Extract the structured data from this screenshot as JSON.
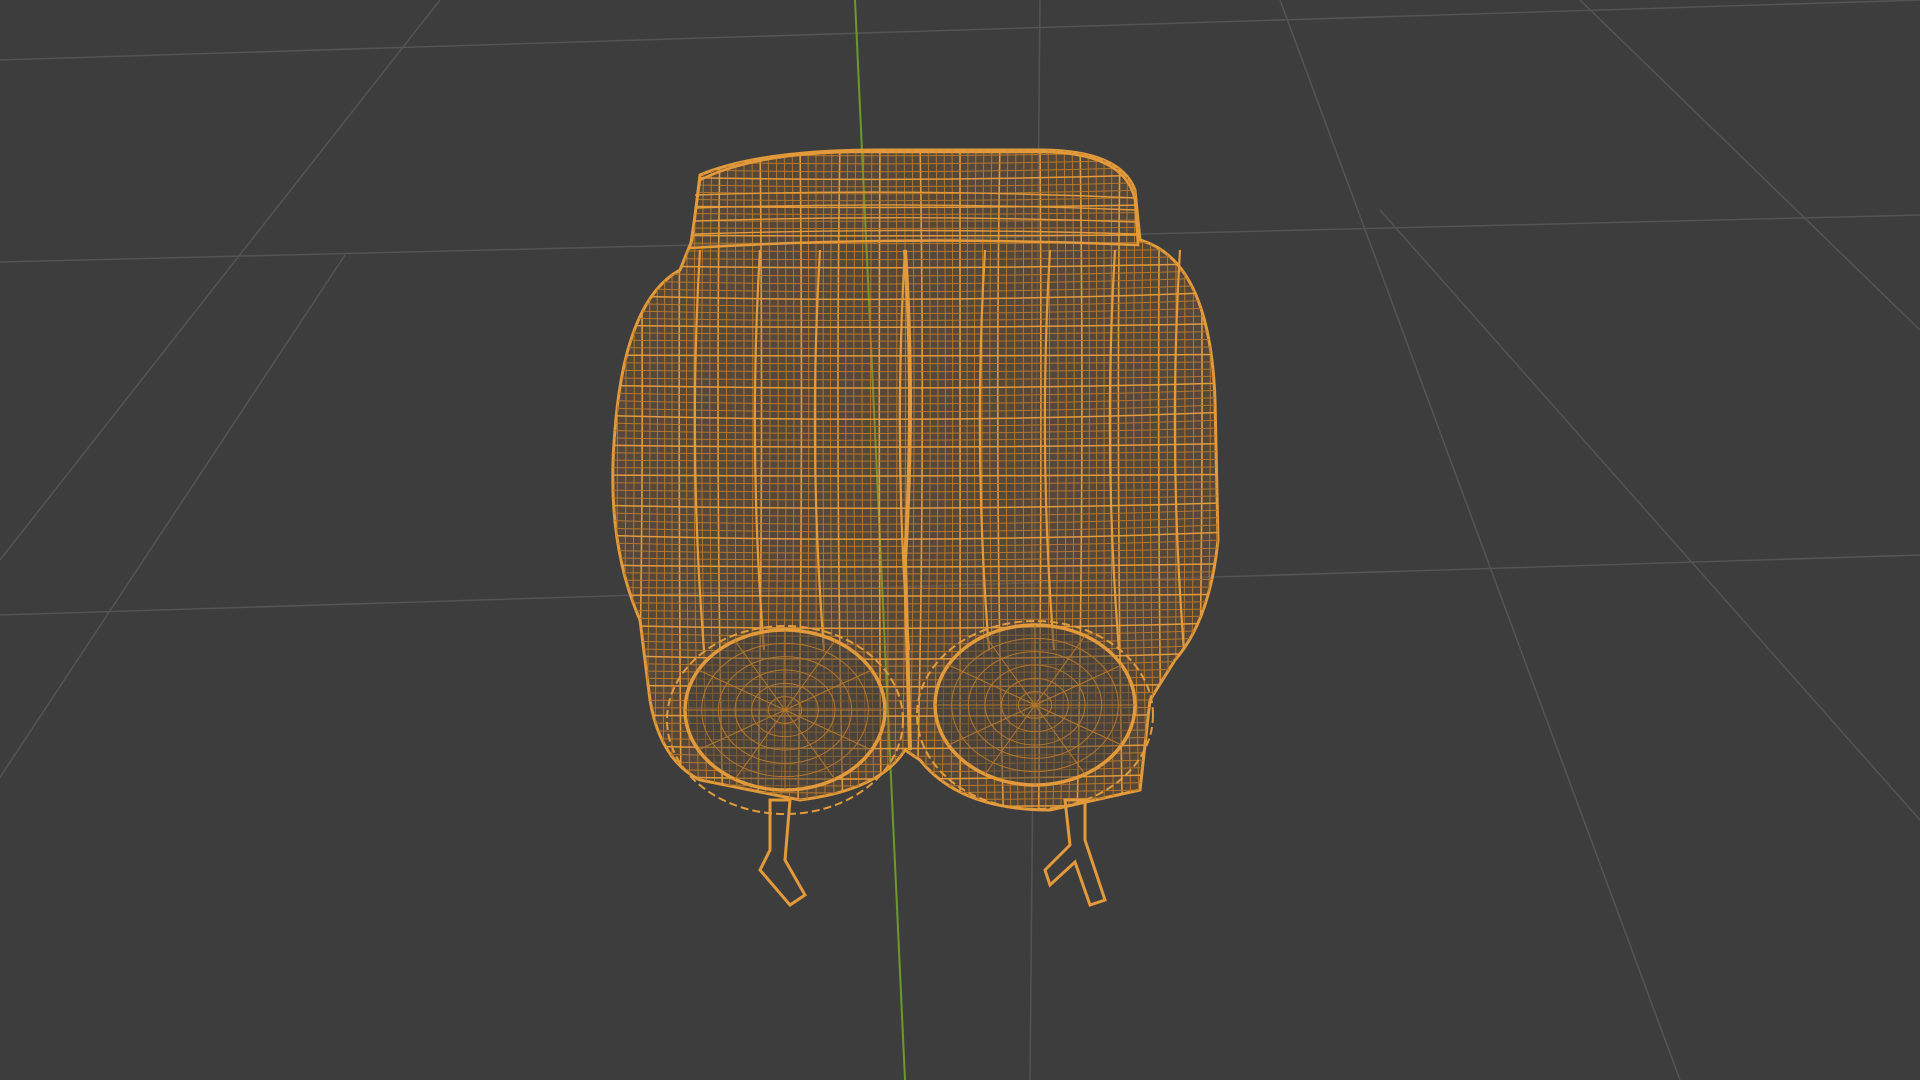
{
  "viewport": {
    "name": "3D Viewport",
    "mode": "wireframe",
    "background_color": "#3d3d3d",
    "grid_color": "#545454",
    "z_axis_color": "#6b9a2a",
    "wire_color": "#e39a3a",
    "wire_color_dark": "#b5762a"
  },
  "object": {
    "description_icon": "wireframe-mesh-icon",
    "selected": true
  }
}
